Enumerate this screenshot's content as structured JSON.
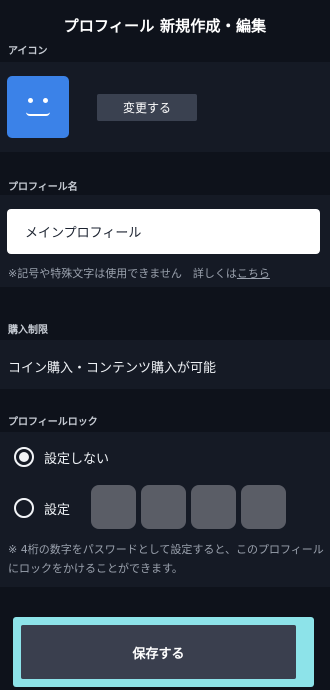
{
  "header": {
    "title": "プロフィール 新規作成・編集"
  },
  "icon_section": {
    "label": "アイコン",
    "avatar_color": "#3b82e8",
    "avatar_icon": "smiley-face-icon",
    "change_button": "変更する"
  },
  "name_section": {
    "label": "プロフィール名",
    "value": "メインプロフィール",
    "note": "※記号や特殊文字は使用できません　詳しくは",
    "note_link": "こちら"
  },
  "purchase_section": {
    "label": "購入制限",
    "value": "コイン購入・コンテンツ購入が可能"
  },
  "lock_section": {
    "label": "プロフィールロック",
    "options": [
      {
        "label": "設定しない",
        "selected": true
      },
      {
        "label": "設定",
        "selected": false
      }
    ],
    "pin_digits": 4,
    "note": "※ 4桁の数字をパスワードとして設定すると、このプロフィールにロックをかけることができます。"
  },
  "save_button": "保存する",
  "colors": {
    "background": "#0e121b",
    "panel": "#151a25",
    "focus_ring": "#8de3e9",
    "button": "#3a3f4e"
  }
}
